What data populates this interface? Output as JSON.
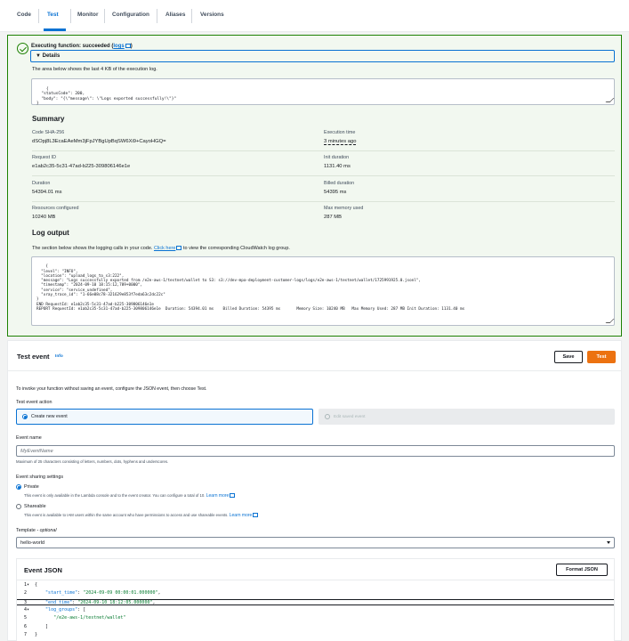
{
  "tabs": [
    {
      "label": "Code"
    },
    {
      "label": "Test"
    },
    {
      "label": "Monitor"
    },
    {
      "label": "Configuration"
    },
    {
      "label": "Aliases"
    },
    {
      "label": "Versions"
    }
  ],
  "active_tab": "Test",
  "result": {
    "title": "Executing function: succeeded (",
    "logs_link": "logs",
    "title_end": ")",
    "details_label": "▼ Details",
    "description": "The area below shows the last 4 KB of the execution log.",
    "response": "{\n  \"statusCode\": 200,\n  \"body\": \"{\\\"message\\\": \\\"Logs exported successfully!\\\"}\"\n}",
    "summary_title": "Summary",
    "fields": {
      "code_sha_label": "Code SHA-256",
      "code_sha_value": "dSOpj8L3EcaEAeMm3jFpJYBgUpBqSW6Xi9+CayoHGQ=",
      "execution_time_label": "Execution time",
      "execution_time_value": "3 minutes ago",
      "request_id_label": "Request ID",
      "request_id_value": "e1ab2c35-5c31-47ad-b225-309806146e1e",
      "init_duration_label": "Init duration",
      "init_duration_value": "1131.40 ms",
      "duration_label": "Duration",
      "duration_value": "54394.01 ms",
      "billed_duration_label": "Billed duration",
      "billed_duration_value": "54395 ms",
      "resources_label": "Resources configured",
      "resources_value": "10240 MB",
      "max_memory_label": "Max memory used",
      "max_memory_value": "287 MB"
    },
    "log_output_title": "Log output",
    "log_desc_pre": "The section below shows the logging calls in your code.",
    "log_click_here": "Click here",
    "log_desc_post": "to view the corresponding CloudWatch log group.",
    "log_text": "{\n  \"level\": \"INFO\",\n  \"location\": \"upload_logs_to_s3:222\",\n  \"message\": \"Logs successfully exported from /e2e-aws-1/testnet/wallet to S3: s3://dev-mpa-deployment-customer-logs/logs/e2e-aws-1/testnet/wallet/1725991925.0.jsonl\",\n  \"timestamp\": \"2024-09-10 18:15:12,789+0000\",\n  \"service\": \"service_undefined\",\n  \"xray_trace_id\": \"1-66e08c78-321629e853f7eda63c2dc22c\"\n}\nEND RequestId: e1ab2c35-5c31-47ad-b225-309806146e1e\nREPORT RequestId: e1ab2c35-5c31-47ad-b225-309806146e1e  Duration: 54394.01 ms    Billed Duration: 54395 ms       Memory Size: 10240 MB   Max Memory Used: 287 MB Init Duration: 1131.40 ms"
  },
  "test_event": {
    "title": "Test event",
    "info": "Info",
    "save_label": "Save",
    "test_label": "Test",
    "intro": "To invoke your function without saving an event, configure the JSON event, then choose Test.",
    "action_label": "Test event action",
    "create_new": "Create new event",
    "edit_saved": "Edit saved event",
    "event_name_label": "Event name",
    "event_name_placeholder": "MyEventName",
    "event_name_hint": "Maximum of 25 characters consisting of letters, numbers, dots, hyphens and underscores.",
    "sharing_label": "Event sharing settings",
    "private_label": "Private",
    "private_desc": "This event is only available in the Lambda console and to the event creator. You can configure a total of 10.",
    "learn_more": "Learn more",
    "shareable_label": "Shareable",
    "shareable_desc": "This event is available to IAM users within the same account who have permissions to access and use shareable events.",
    "template_label": "Template",
    "template_optional": " - optional",
    "template_value": "hello-world",
    "json_title": "Event JSON",
    "format_json": "Format JSON",
    "lines": [
      {
        "num": "1",
        "fold": "▾",
        "indent": "",
        "key": "",
        "sep": "",
        "val": "",
        "tail": "{"
      },
      {
        "num": "2",
        "fold": "",
        "indent": "    ",
        "key": "\"start_time\"",
        "sep": ": ",
        "val": "\"2024-09-09 00:00:01.000000\"",
        "tail": ","
      },
      {
        "num": "3",
        "fold": "",
        "indent": "    ",
        "key": "\"end_time\"",
        "sep": ": ",
        "val": "\"2024-09-10 18:12:05.000000\"",
        "tail": ","
      },
      {
        "num": "4",
        "fold": "▾",
        "indent": "    ",
        "key": "\"log_groups\"",
        "sep": ": ",
        "val": "",
        "tail": "["
      },
      {
        "num": "5",
        "fold": "",
        "indent": "       ",
        "key": "",
        "sep": "",
        "val": "\"/e2e-aws-1/testnet/wallet\"",
        "tail": ""
      },
      {
        "num": "6",
        "fold": "",
        "indent": "    ",
        "key": "",
        "sep": "",
        "val": "",
        "tail": "]"
      },
      {
        "num": "7",
        "fold": "",
        "indent": "",
        "key": "",
        "sep": "",
        "val": "",
        "tail": "}"
      }
    ]
  },
  "colors": {
    "accent": "#0972d3",
    "success": "#1d8102",
    "primary_button": "#ec7211"
  }
}
